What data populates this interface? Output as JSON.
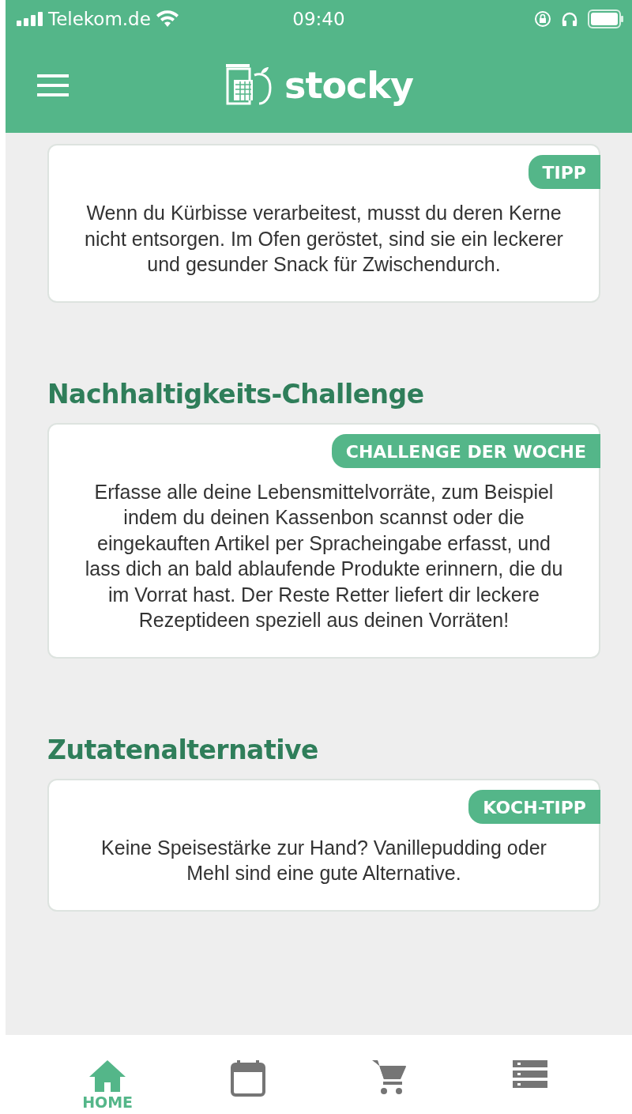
{
  "status_bar": {
    "carrier": "Telekom.de",
    "time": "09:40"
  },
  "app_bar": {
    "logo_text": "stocky"
  },
  "sections": [
    {
      "badge": "TIPP",
      "text": "Wenn du Kürbisse verarbeitest, musst du deren Kerne nicht entsorgen. Im Ofen geröstet, sind sie ein leckerer und gesunder Snack für Zwischendurch."
    },
    {
      "heading": "Nachhaltigkeits-Challenge",
      "badge": "CHALLENGE DER WOCHE",
      "text": "Erfasse alle deine Lebensmittelvorräte, zum Beispiel indem du deinen Kassenbon scannst oder die eingekauften Artikel per Spracheingabe erfasst, und lass dich an bald ablaufende Produkte erinnern, die du im Vorrat hast. Der Reste Retter liefert dir leckere Rezeptideen speziell aus deinen Vorräten!"
    },
    {
      "heading": "Zutatenalternative",
      "badge": "KOCH-TIPP",
      "text": "Keine Speisestärke zur Hand? Vanillepudding oder Mehl sind eine gute Alternative."
    }
  ],
  "tab_bar": [
    {
      "kind": "home",
      "label": "HOME",
      "selected": true
    },
    {
      "kind": "calendar",
      "selected": false
    },
    {
      "kind": "cart",
      "selected": false
    },
    {
      "kind": "list",
      "selected": false
    }
  ]
}
